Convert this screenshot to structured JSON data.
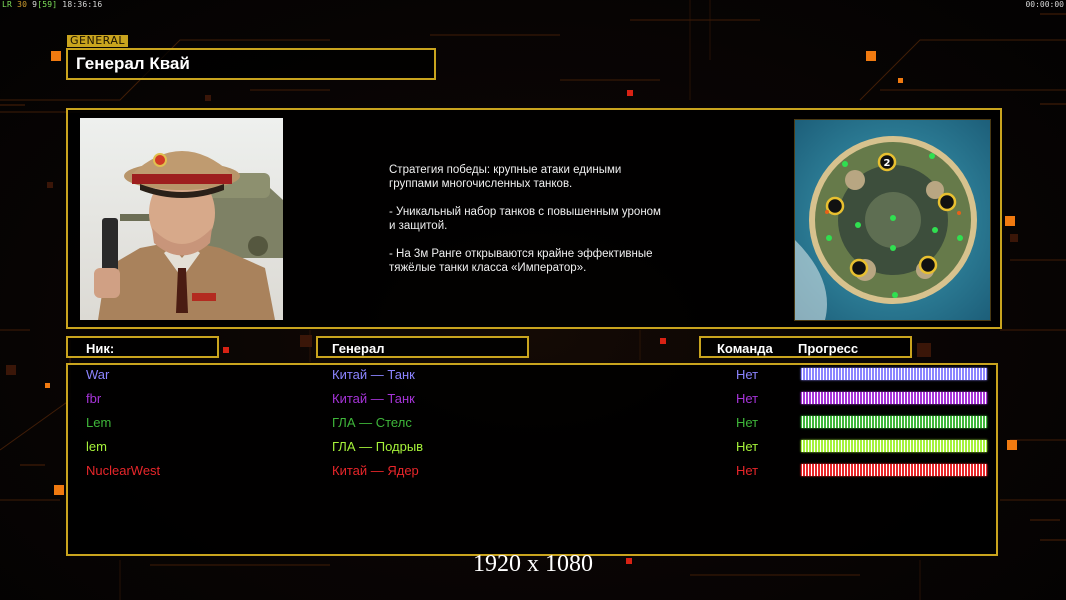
{
  "hud": {
    "top_left_a": "LR",
    "top_left_b": "30",
    "top_left_c": "9",
    "top_left_d": "[59]",
    "top_left_e": "18:36:16",
    "top_right": "00:00:00"
  },
  "general": {
    "tag": "GENERAL",
    "name": "Генерал Квай",
    "description": [
      "Стратегия победы: крупные атаки едиными\n группами многочисленных танков.",
      "- Уникальный набор танков с повышенным уроном\n и защитой.",
      "- На 3м Ранге открываются крайне эффективные\n тяжёлые танки класса «Император»."
    ],
    "map_marker": "2"
  },
  "table": {
    "headers": {
      "nick": "Ник:",
      "general": "Генерал",
      "team": "Команда",
      "progress": "Прогресс"
    },
    "players": [
      {
        "nick": "War",
        "general": "Китай — Танк",
        "team": "Нет",
        "color": "#8c84ff",
        "progress": 1.0
      },
      {
        "nick": "fbr",
        "general": "Китай — Танк",
        "team": "Нет",
        "color": "#a634d8",
        "progress": 1.0
      },
      {
        "nick": "Lem",
        "general": "ГЛА — Стелс",
        "team": "Нет",
        "color": "#3fb63a",
        "progress": 1.0
      },
      {
        "nick": "lem",
        "general": "ГЛА — Подрыв",
        "team": "Нет",
        "color": "#a6f23a",
        "progress": 1.0
      },
      {
        "nick": "NuclearWest",
        "general": "Китай — Ядер",
        "team": "Нет",
        "color": "#e8262a",
        "progress": 1.0
      }
    ]
  },
  "footer": {
    "resolution": "1920 x 1080"
  },
  "colors": {
    "frame": "#c9a41e",
    "accent": "#f07a10"
  }
}
